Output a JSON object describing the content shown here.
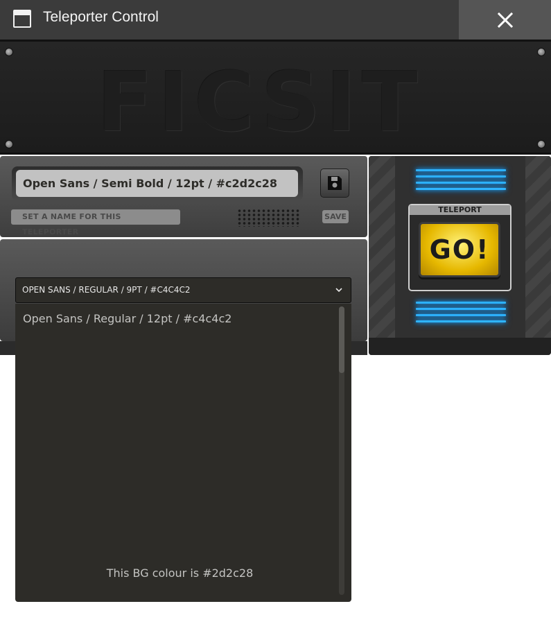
{
  "window": {
    "title": "Teleporter Control",
    "close_icon": "close-icon"
  },
  "header": {
    "logo_text": "FICSIT"
  },
  "name_panel": {
    "input_value": "Open Sans / Semi Bold / 12pt / #c2d2c28",
    "label": "SET A NAME FOR THIS TELEPORTER",
    "save_label": "SAVE"
  },
  "dropdown": {
    "selected": "OPEN SANS / REGULAR / 9PT / #C4C4C2",
    "options": [
      "Open Sans / Regular / 12pt / #c4c4c2"
    ],
    "bg_note": "This BG colour is #2d2c28"
  },
  "teleport": {
    "label": "TELEPORT",
    "button": "GO!"
  },
  "colors": {
    "text_input": "#2d2c28",
    "list_bg": "#2d2c28",
    "list_text": "#c4c4c2",
    "glow": "#2fb4ff",
    "go_yellow": "#e6b800"
  }
}
